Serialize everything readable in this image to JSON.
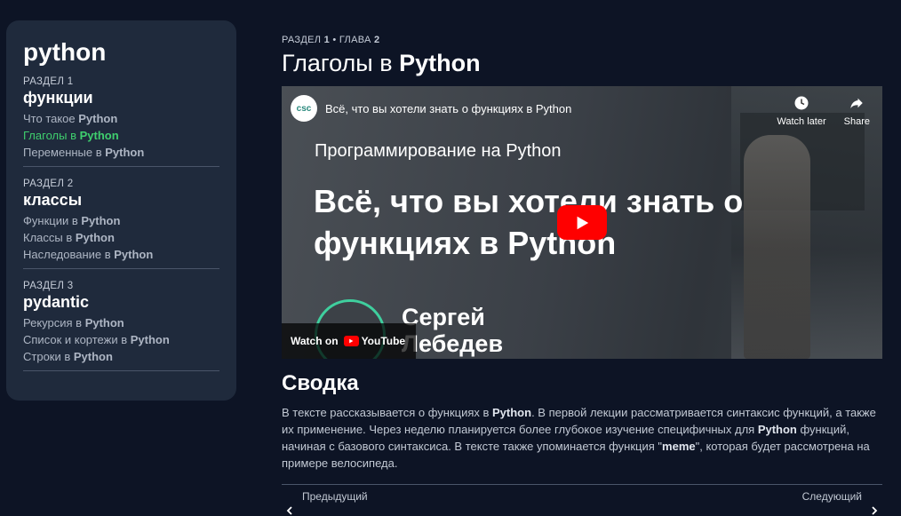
{
  "sidebar": {
    "title": "python",
    "sections": [
      {
        "kicker": "РАЗДЕЛ 1",
        "title": "функции",
        "items": [
          {
            "pre": "Что такое ",
            "kw": "Python",
            "active": false
          },
          {
            "pre": "Глаголы в ",
            "kw": "Python",
            "active": true
          },
          {
            "pre": "Переменные в ",
            "kw": "Python",
            "active": false
          }
        ]
      },
      {
        "kicker": "РАЗДЕЛ 2",
        "title": "классы",
        "items": [
          {
            "pre": "Функции в ",
            "kw": "Python",
            "active": false
          },
          {
            "pre": "Классы в ",
            "kw": "Python",
            "active": false
          },
          {
            "pre": "Наследование в ",
            "kw": "Python",
            "active": false
          }
        ]
      },
      {
        "kicker": "РАЗДЕЛ 3",
        "title": "pydantic",
        "items": [
          {
            "pre": "Рекурсия в ",
            "kw": "Python",
            "active": false
          },
          {
            "pre": "Список и кортежи в ",
            "kw": "Python",
            "active": false
          },
          {
            "pre": "Строки в ",
            "kw": "Python",
            "active": false
          }
        ]
      }
    ]
  },
  "main": {
    "kicker": {
      "a": "РАЗДЕЛ ",
      "b": "1",
      "c": " • ГЛАВА ",
      "d": "2"
    },
    "title": {
      "pre": "Глаголы в ",
      "kw": "Python"
    },
    "video": {
      "channel_logo": "csc",
      "title": "Всё, что вы хотели знать о функциях в Python",
      "watch_later": "Watch later",
      "share": "Share",
      "subtitle": "Программирование на Python",
      "headline": "Всё, что вы хотели знать о функциях в Python",
      "author_first": "Сергей",
      "author_last": "Лебедев",
      "watch_on": "Watch on",
      "youtube": "YouTube"
    },
    "summary": {
      "title": "Сводка",
      "parts": [
        "В тексте рассказывается о функциях в ",
        "Python",
        ". В первой лекции рассматривается синтаксис функций, а также их применение. Через неделю планируется более глубокое изучение специфичных для ",
        "Python",
        " функций, начиная с базового синтаксиса. В тексте также упоминается функция \"",
        "meme",
        "\", которая будет рассмотрена на примере велосипеда."
      ]
    },
    "pager": {
      "prev_label": "Предыдущий",
      "next_label": "Следующий"
    }
  },
  "colors": {
    "background": "#0d1425",
    "sidebar": "#1f2a3c",
    "active": "#3fcf6e",
    "youtube_red": "#ff0000"
  }
}
